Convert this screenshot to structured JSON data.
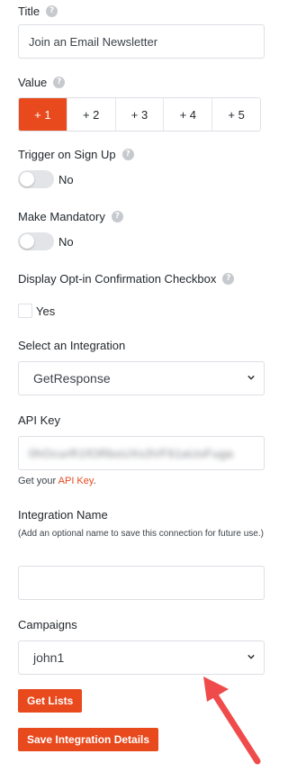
{
  "title_field": {
    "label": "Title",
    "value": "Join an Email Newsletter"
  },
  "value_field": {
    "label": "Value",
    "options": [
      "+ 1",
      "+ 2",
      "+ 3",
      "+ 4",
      "+ 5"
    ],
    "selected": "+ 1"
  },
  "trigger_on_signup": {
    "label": "Trigger on Sign Up",
    "state": "No"
  },
  "make_mandatory": {
    "label": "Make Mandatory",
    "state": "No"
  },
  "optin_checkbox": {
    "label": "Display Opt-in Confirmation Checkbox",
    "option_label": "Yes"
  },
  "integration": {
    "label": "Select an Integration",
    "selected": "GetResponse"
  },
  "api_key": {
    "label": "API Key",
    "value": "0hOcurR1fORboUXs3VF61aUoFuga",
    "help_prefix": "Get your ",
    "help_link": "API Key",
    "help_suffix": "."
  },
  "integration_name": {
    "label": "Integration Name",
    "note": "(Add an optional name to save this connection for future use.)",
    "value": ""
  },
  "campaigns": {
    "label": "Campaigns",
    "selected": "john1"
  },
  "buttons": {
    "get_lists": "Get Lists",
    "save_integration": "Save Integration Details"
  },
  "icons": {
    "help": "?",
    "chevron": "chevron-down-icon",
    "arrow": "red-arrow-annotation"
  },
  "colors": {
    "accent": "#e8491d",
    "arrow": "#ef4b4b"
  }
}
